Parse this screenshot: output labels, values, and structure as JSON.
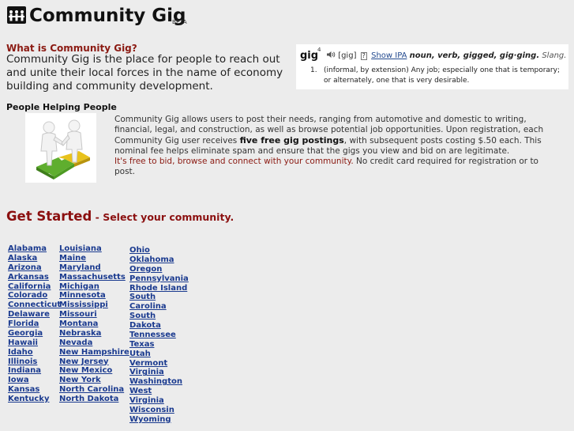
{
  "header": {
    "title": "Community Gig",
    "beta": "BETA"
  },
  "intro": {
    "heading": "What is Community Gig?",
    "text": "Community Gig is the place for people to reach out and unite their local forces in the name of economy building and community development."
  },
  "dictionary": {
    "word": "gig",
    "superscript": "4",
    "pron": "[gig]",
    "help": "?",
    "ipa": "Show IPA",
    "pos": "noun, verb, gigged, gig·ging.",
    "slang": "Slang.",
    "num": "1.",
    "definition": "(informal, by extension) Any job; especially one that is temporary; or alternately, one that is very desirable."
  },
  "people": {
    "heading": "People Helping People",
    "p1": "Community Gig allows users to post their needs, ranging from automotive and domestic to writing, financial, legal, and construction, as well as browse potential job opportunities. Upon registration, each Community Gig user receives ",
    "bold": "five free gig postings",
    "p2": ", with subsequent posts costing $.50 each. This nominal fee helps eliminate spam and ensure that the gigs you view and bid on are legitimate.",
    "red": "It's free to bid, browse and connect with your community.",
    "p3": " No credit card required for registration or to post."
  },
  "get_started": {
    "title": "Get Started",
    "subtitle": " - Select your community."
  },
  "states": {
    "col1": [
      "Alabama",
      "Alaska",
      "Arizona",
      "Arkansas",
      "California",
      "Colorado",
      "Connecticut",
      "Delaware",
      "Florida",
      "Georgia",
      "Hawaii",
      "Idaho",
      "Illinois",
      "Indiana",
      "Iowa",
      "Kansas",
      "Kentucky"
    ],
    "col2": [
      "Louisiana",
      "Maine",
      "Maryland",
      "Massachusetts",
      "Michigan",
      "Minnesota",
      "Mississippi",
      "Missouri",
      "Montana",
      "Nebraska",
      "Nevada",
      "New Hampshire",
      "New Jersey",
      "New Mexico",
      "New York",
      "North Carolina",
      "North Dakota"
    ],
    "col3": [
      "Ohio",
      "Oklahoma",
      "Oregon",
      "Pennsylvania",
      "Rhode Island",
      "South",
      "Carolina",
      "South",
      "Dakota",
      "Tennessee",
      "Texas",
      "Utah",
      "Vermont",
      "Virginia",
      "Washington",
      "West",
      "Virginia",
      "Wisconsin",
      "Wyoming"
    ]
  },
  "colors": {
    "accent_red": "#8b1010",
    "link_blue": "#1a3a8f",
    "background": "#ececec"
  }
}
